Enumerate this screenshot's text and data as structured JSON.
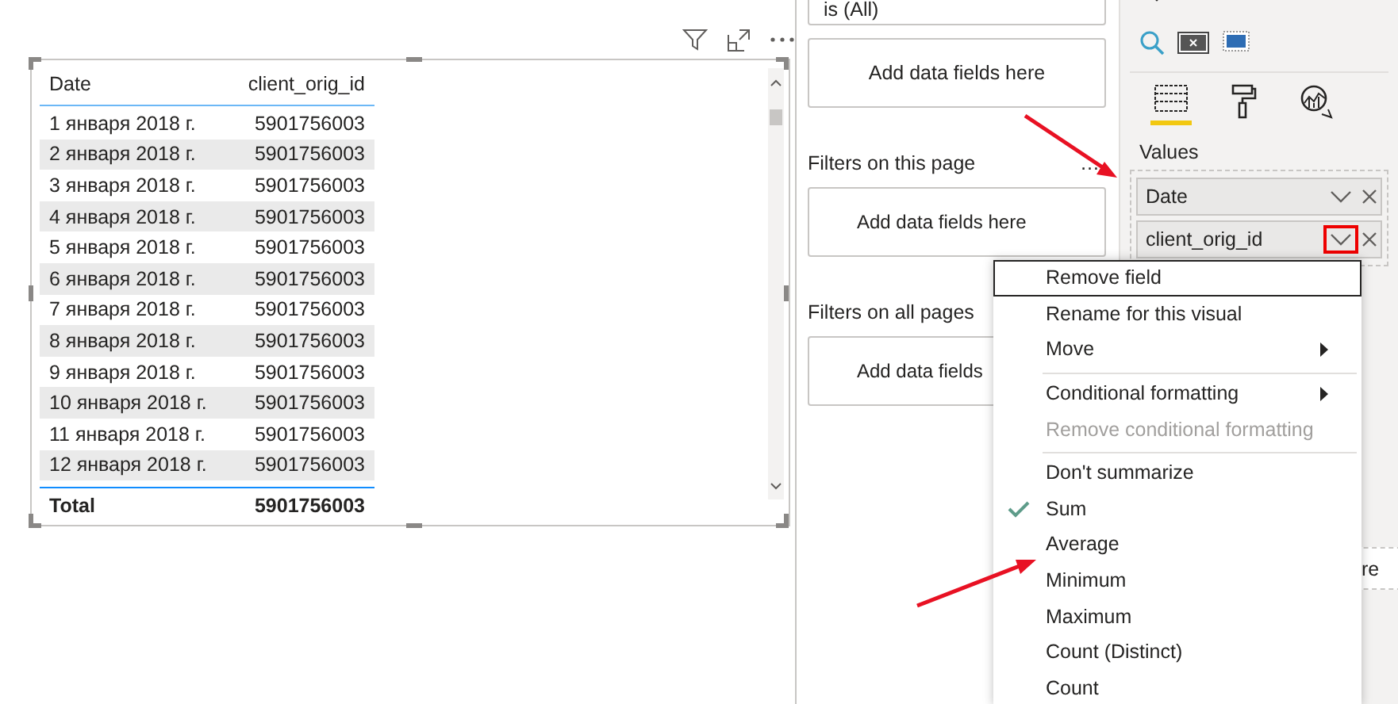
{
  "table_visual": {
    "columns": [
      "Date",
      "client_orig_id"
    ],
    "rows": [
      [
        "1 января 2018 г.",
        "5901756003"
      ],
      [
        "2 января 2018 г.",
        "5901756003"
      ],
      [
        "3 января 2018 г.",
        "5901756003"
      ],
      [
        "4 января 2018 г.",
        "5901756003"
      ],
      [
        "5 января 2018 г.",
        "5901756003"
      ],
      [
        "6 января 2018 г.",
        "5901756003"
      ],
      [
        "7 января 2018 г.",
        "5901756003"
      ],
      [
        "8 января 2018 г.",
        "5901756003"
      ],
      [
        "9 января 2018 г.",
        "5901756003"
      ],
      [
        "10 января 2018 г.",
        "5901756003"
      ],
      [
        "11 января 2018 г.",
        "5901756003"
      ],
      [
        "12 января 2018 г.",
        "5901756003"
      ]
    ],
    "total": [
      "Total",
      "5901756003"
    ]
  },
  "filters_pane": {
    "top_filter": "is (All)",
    "visual_well": "Add data fields here",
    "sections": [
      {
        "title": "Filters on this page",
        "more": "…",
        "well": "Add data fields here"
      },
      {
        "title": "Filters on all pages",
        "well": "Add data fields"
      }
    ]
  },
  "visualizations_pane": {
    "tabs": [
      {
        "selected": true
      },
      {
        "selected": false
      },
      {
        "selected": false
      }
    ],
    "values_label": "Values",
    "fields": [
      {
        "name": "Date",
        "highlighted": false
      },
      {
        "name": "client_orig_id",
        "highlighted": true
      }
    ],
    "lower_well": "re"
  },
  "context_menu": [
    {
      "label": "Remove field",
      "selected": true,
      "separator_before": false,
      "submenu": false,
      "disabled": false,
      "checked": false
    },
    {
      "label": "Rename for this visual",
      "selected": false,
      "separator_before": false,
      "submenu": false,
      "disabled": false,
      "checked": false
    },
    {
      "label": "Move",
      "selected": false,
      "separator_before": false,
      "submenu": true,
      "disabled": false,
      "checked": false
    },
    {
      "label": "Conditional formatting",
      "selected": false,
      "separator_before": true,
      "submenu": true,
      "disabled": false,
      "checked": false
    },
    {
      "label": "Remove conditional formatting",
      "selected": false,
      "separator_before": false,
      "submenu": false,
      "disabled": true,
      "checked": false
    },
    {
      "label": "Don't summarize",
      "selected": false,
      "separator_before": true,
      "submenu": false,
      "disabled": false,
      "checked": false
    },
    {
      "label": "Sum",
      "selected": false,
      "separator_before": false,
      "submenu": false,
      "disabled": false,
      "checked": true
    },
    {
      "label": "Average",
      "selected": false,
      "separator_before": false,
      "submenu": false,
      "disabled": false,
      "checked": false
    },
    {
      "label": "Minimum",
      "selected": false,
      "separator_before": false,
      "submenu": false,
      "disabled": false,
      "checked": false
    },
    {
      "label": "Maximum",
      "selected": false,
      "separator_before": false,
      "submenu": false,
      "disabled": false,
      "checked": false
    },
    {
      "label": "Count (Distinct)",
      "selected": false,
      "separator_before": false,
      "submenu": false,
      "disabled": false,
      "checked": false
    },
    {
      "label": "Count",
      "selected": false,
      "separator_before": false,
      "submenu": false,
      "disabled": false,
      "checked": false
    }
  ]
}
